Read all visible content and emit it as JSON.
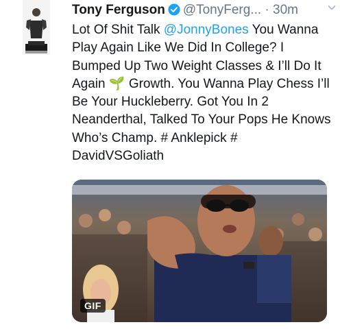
{
  "tweet": {
    "author_name": "Tony Ferguson",
    "handle": "@TonyFerg...",
    "separator": "·",
    "time": "30m",
    "text_before_mention": "Lot Of Shit Talk ",
    "mention": "@JonnyBones",
    "text_main": " You Wanna Play Again Like We Did In College? I Bumped Up Two Weight Classes & I’ll Do It Again ",
    "emoji": "🌱",
    "text_after_emoji": " Growth. You Wanna Play Chess I’ll Be Your Huckleberry. Got You In 2 Neanderthal, Talked To Your Pops He Knows Who’s Champ. ",
    "hashtag_1": "# Anklepick",
    "hashtag_2": "# DavidVSGoliath",
    "media_badge": "GIF"
  },
  "icons": {
    "verified": "verified-badge-icon",
    "menu": "chevron-down-icon"
  },
  "colors": {
    "link": "#1da1f2",
    "secondary_text": "#657786",
    "verified": "#1da1f2"
  }
}
